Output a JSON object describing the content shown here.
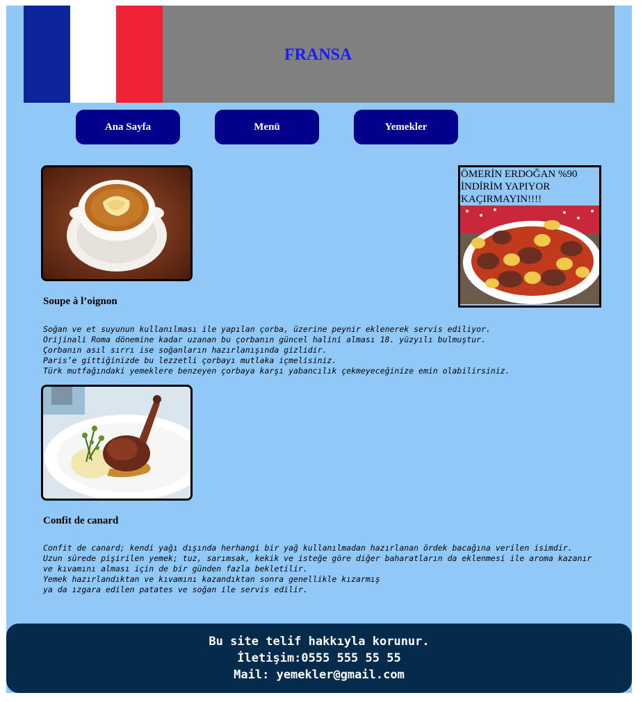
{
  "header": {
    "title": "FRANSA",
    "flag_colors": [
      "#0a2499",
      "#ffffff",
      "#ee2436"
    ]
  },
  "nav": {
    "items": [
      "Ana Sayfa",
      "Menü",
      "Yemekler"
    ]
  },
  "dishes": [
    {
      "name": "Soupe à l’oignon",
      "image": "onion-soup-photo",
      "description": "Soğan ve et suyunun kullanılması ile yapılan çorba, üzerine peynir eklenerek servis ediliyor.\nOrijinali Roma dönemine kadar uzanan bu çorbanın güncel halini alması 18. yüzyılı bulmuştur.\nÇorbanın asıl sırrı ise soğanların hazırlanışında gizlidir.\nParis’e gittiğinizde bu lezzetli çorbayı mutlaka içmelisiniz.\nTürk mutfağındaki yemeklere benzeyen çorbaya karşı yabancılık çekmeyeceğinize emin olabilirsiniz."
    },
    {
      "name": "Confit de canard",
      "image": "duck-confit-photo",
      "description": "Confit de canard; kendi yağı dışında herhangi bir yağ kullanılmadan hazırlanan ördek bacağına verilen isimdir.\nUzun sürede pişirilen yemek; tuz, sarımsak, kekik ve isteğe göre diğer baharatların da eklenmesi ile aroma kazanır\nve kıvamını alması için de bir günden fazla bekletilir.\nYemek hazırlandıktan ve kıvamını kazandıktan sonra genellikle kızarmış\nya da ızgara edilen patates ve soğan ile servis edilir."
    }
  ],
  "ad": {
    "text": "ÖMERİN ERDOĞAN %90 İNDİRİM YAPIYOR KAÇIRMAYIN!!!!",
    "image": "meatball-potato-dish-photo"
  },
  "footer": {
    "line1": "Bu site telif hakkıyla korunur.",
    "line2": "İletişim:0555 555 55 55",
    "line3": "Mail: yemekler@gmail.com"
  },
  "colors": {
    "page_bg": "#90c8f8",
    "header_bg": "#808080",
    "nav_bg": "#03008c",
    "title": "#1a1aff",
    "footer_bg": "#042a4c"
  }
}
